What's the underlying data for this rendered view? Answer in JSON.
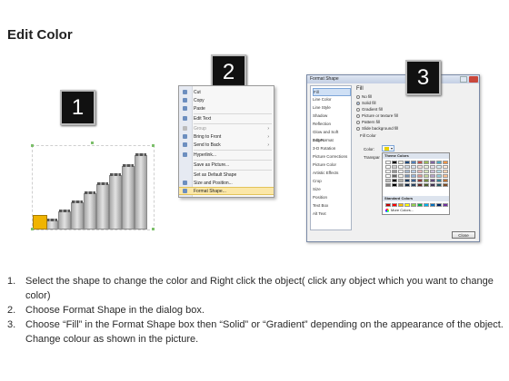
{
  "page": {
    "title": "Edit Color"
  },
  "badges": [
    "1",
    "2",
    "3"
  ],
  "menu": {
    "items": [
      {
        "label": "Cut",
        "arrow": ""
      },
      {
        "label": "Copy",
        "arrow": ""
      },
      {
        "label": "Paste",
        "arrow": ""
      },
      {
        "label": "Edit Text",
        "arrow": ""
      },
      {
        "label": "Group",
        "arrow": "›"
      },
      {
        "label": "Bring to Front",
        "arrow": "›"
      },
      {
        "label": "Send to Back",
        "arrow": "›"
      },
      {
        "label": "Hyperlink...",
        "arrow": ""
      },
      {
        "label": "Save as Picture...",
        "arrow": ""
      },
      {
        "label": "Set as Default Shape",
        "arrow": ""
      },
      {
        "label": "Size and Position...",
        "arrow": ""
      },
      {
        "label": "Format Shape...",
        "arrow": ""
      }
    ]
  },
  "dialog": {
    "title": "Format Shape",
    "categories": [
      "Fill",
      "Line Color",
      "Line Style",
      "Shadow",
      "Reflection",
      "Glow and Soft Edges",
      "3-D Format",
      "3-D Rotation",
      "Picture Corrections",
      "Picture Color",
      "Artistic Effects",
      "Crop",
      "Size",
      "Position",
      "Text Box",
      "Alt Text"
    ],
    "fill_header": "Fill",
    "fill_options": [
      "No fill",
      "Solid fill",
      "Gradient fill",
      "Picture or texture fill",
      "Pattern fill",
      "Slide background fill"
    ],
    "fill_color_label": "Fill Color",
    "color_label": "Color:",
    "transparency_label": "Transpar",
    "theme_colors_label": "Theme Colors",
    "standard_colors_label": "Standard Colors",
    "more_colors_label": "More Colors...",
    "close_label": "Close",
    "theme_colors": [
      "#ffffff",
      "#000000",
      "#eeece1",
      "#1f497d",
      "#4f81bd",
      "#c0504d",
      "#9bbb59",
      "#8064a2",
      "#4bacc6",
      "#f79646"
    ],
    "standard_colors": [
      "#c00000",
      "#ff0000",
      "#ffc000",
      "#ffff00",
      "#92d050",
      "#00b050",
      "#00b0f0",
      "#0070c0",
      "#002060",
      "#7030a0"
    ]
  },
  "instructions": [
    {
      "num": "1.",
      "text": "Select the shape to change the color and Right click the object( click any object which you want to change color)"
    },
    {
      "num": "2.",
      "text": "Choose Format Shape in the dialog box."
    },
    {
      "num": "3.",
      "text": "Choose “Fill” in the Format Shape box then “Solid” or “Gradient” depending on the appearance of the object. Change colour as shown in the picture."
    }
  ]
}
